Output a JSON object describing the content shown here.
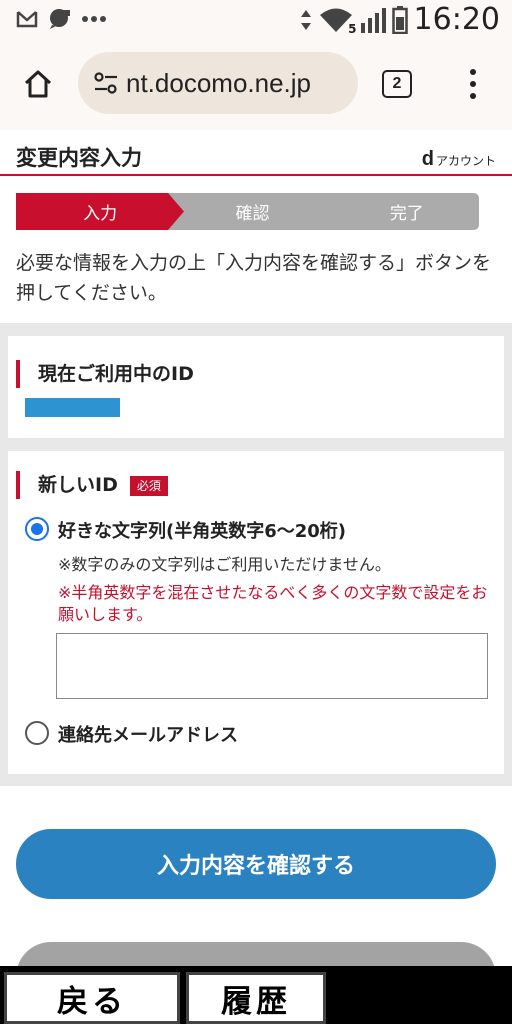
{
  "status_bar": {
    "icons": [
      "gmail-icon",
      "chat-icon",
      "more-dots-icon"
    ],
    "right_icons": [
      "data-arrows-icon",
      "wifi-5g-icon",
      "signal-icon",
      "battery-icon"
    ],
    "network_label": "5",
    "time": "16:20"
  },
  "browser": {
    "url": "nt.docomo.ne.jp",
    "tab_count": "2"
  },
  "page": {
    "title": "変更内容入力",
    "logo_letter": "d",
    "logo_text": "アカウント",
    "steps": [
      {
        "label": "入力",
        "active": true
      },
      {
        "label": "確認",
        "active": false
      },
      {
        "label": "完了",
        "active": false
      }
    ],
    "intro": "必要な情報を入力の上「入力内容を確認する」ボタンを押してください。",
    "current_id": {
      "heading": "現在ご利用中のID"
    },
    "new_id": {
      "heading": "新しいID",
      "required_badge": "必須",
      "option1": {
        "label": "好きな文字列(半角英数字6〜20桁)",
        "checked": true,
        "note": "※数字のみの文字列はご利用いただけません。",
        "warning": "※半角英数字を混在させたなるべく多くの文字数で設定をお願いします。",
        "value": ""
      },
      "option2": {
        "label": "連絡先メールアドレス",
        "checked": false
      }
    },
    "confirm_button": "入力内容を確認する"
  },
  "bottom_nav": {
    "back": "戻る",
    "history": "履歴"
  },
  "colors": {
    "brand_red": "#c8102e",
    "button_blue": "#2b82c1",
    "radio_blue": "#1a73e8"
  }
}
